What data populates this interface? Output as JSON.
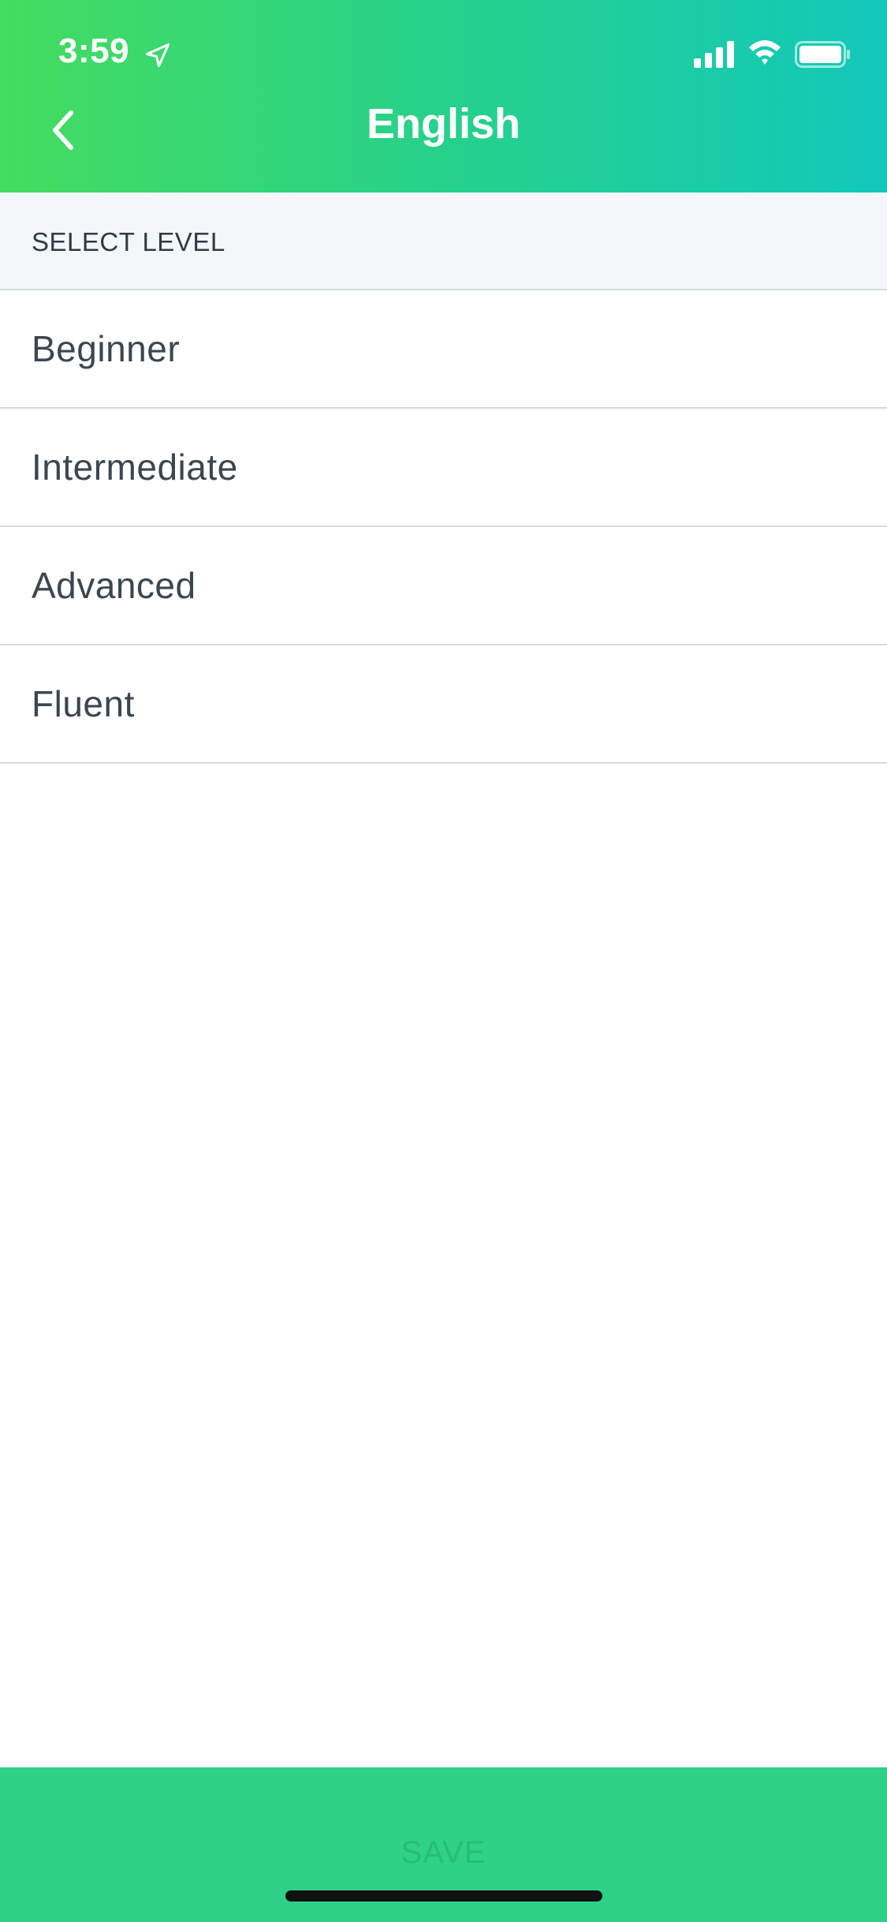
{
  "status_bar": {
    "time": "3:59",
    "icons": [
      "location-arrow-icon",
      "cellular-signal-icon",
      "wifi-icon",
      "battery-icon"
    ]
  },
  "nav": {
    "back_icon": "chevron-left-icon",
    "title": "English"
  },
  "section": {
    "title": "SELECT LEVEL"
  },
  "levels": [
    {
      "label": "Beginner"
    },
    {
      "label": "Intermediate"
    },
    {
      "label": "Advanced"
    },
    {
      "label": "Fluent"
    }
  ],
  "footer": {
    "save_label": "SAVE"
  },
  "colors": {
    "header_gradient_start": "#45dc5f",
    "header_gradient_end": "#12c8bb",
    "save_bar": "#2ed186",
    "section_bg": "#f3f7fa",
    "text": "#3c4650"
  }
}
